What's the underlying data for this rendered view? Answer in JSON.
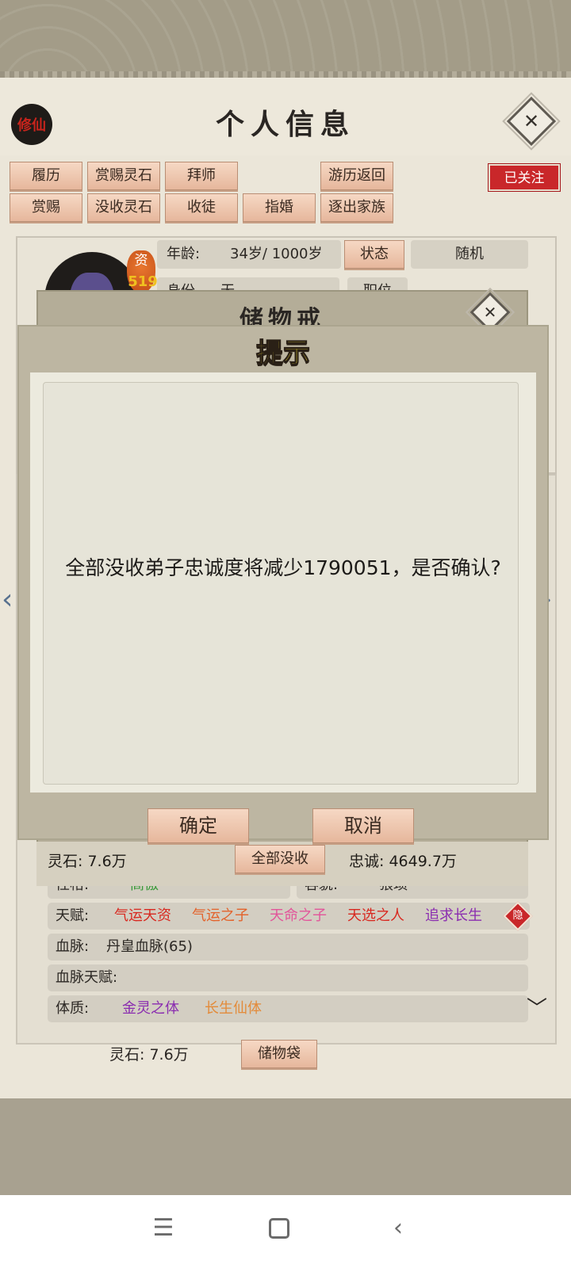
{
  "header": {
    "title": "个人信息",
    "seal_label": "修仙"
  },
  "actions": {
    "row1": [
      "履历",
      "赏赐灵石",
      "拜师",
      "游历返回"
    ],
    "row2": [
      "赏赐",
      "没收灵石",
      "收徒",
      "指婚",
      "逐出家族"
    ],
    "followed": "已关注"
  },
  "profile": {
    "aptitude_label": "资",
    "aptitude_value": "519",
    "age_label": "年龄:",
    "age_value": "34岁/ 1000岁",
    "state_button": "状态",
    "state_value": "随机",
    "identity_label": "身份",
    "identity_value": "无",
    "position_label": "职位"
  },
  "attributes": {
    "personality_label": "性格:",
    "personality_value": "高傲",
    "looks_label": "容貌:",
    "looks_value": "猥琐",
    "talent_label": "天赋:",
    "talents": [
      {
        "text": "气运天资",
        "color": "#d8281f"
      },
      {
        "text": "气运之子",
        "color": "#e3622a"
      },
      {
        "text": "天命之子",
        "color": "#e2559a"
      },
      {
        "text": "天选之人",
        "color": "#d8281f"
      },
      {
        "text": "追求长生",
        "color": "#8a2cb0"
      }
    ],
    "hidden_badge": "隐",
    "bloodline_label": "血脉:",
    "bloodline_value": "丹皇血脉(65)",
    "bloodline_talent_label": "血脉天赋:",
    "physique_label": "体质:",
    "physiques": [
      {
        "text": "金灵之体",
        "color": "#8a2cb0"
      },
      {
        "text": "长生仙体",
        "color": "#e38b3a"
      }
    ]
  },
  "bottom": {
    "spirit_stone": "灵石: 7.6万",
    "bag_button": "储物袋"
  },
  "storage": {
    "title": "储物戒",
    "spirit_stone": "灵石: 7.6万",
    "confiscate_all": "全部没收",
    "loyalty": "忠诚: 4649.7万"
  },
  "dialog": {
    "title": "提示",
    "message": "全部没收弟子忠诚度将减少1790051，是否确认?",
    "confirm": "确定",
    "cancel": "取消"
  },
  "system_nav": {
    "menu_icon": "menu-icon",
    "home_icon": "home-icon",
    "back_icon": "back-icon"
  }
}
